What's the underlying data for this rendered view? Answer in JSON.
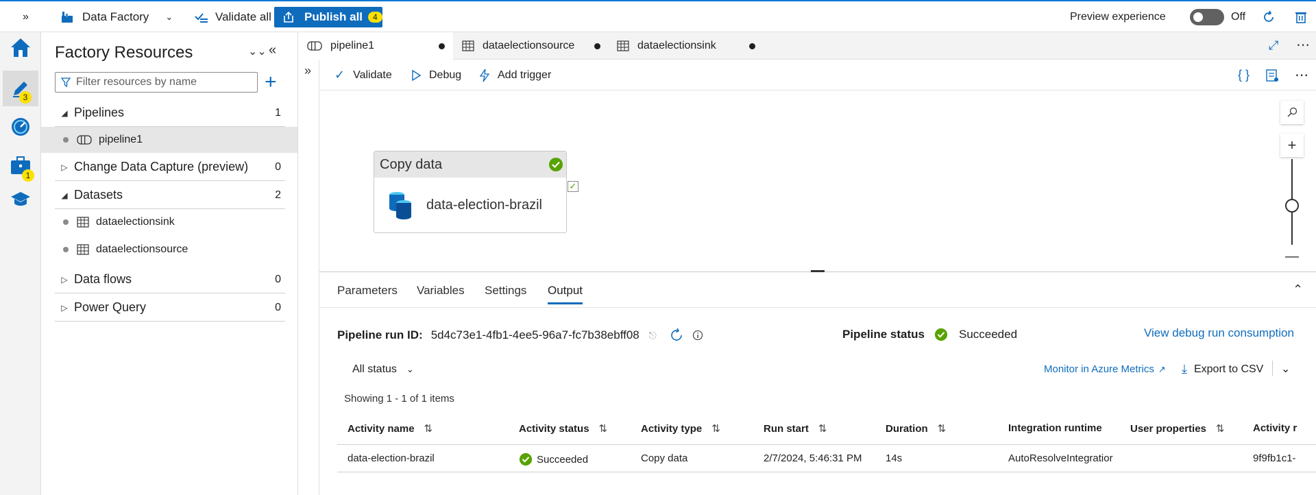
{
  "topbar": {
    "factory_label": "Data Factory",
    "validate_all": "Validate all",
    "publish_all": "Publish all",
    "publish_count": "4",
    "preview_label": "Preview experience",
    "toggle_state": "Off"
  },
  "rail": {
    "author_badge": "3",
    "manage_badge": "1"
  },
  "resources": {
    "title": "Factory Resources",
    "filter_placeholder": "Filter resources by name",
    "groups": [
      {
        "label": "Pipelines",
        "count": "1"
      },
      {
        "label": "Change Data Capture (preview)",
        "count": "0"
      },
      {
        "label": "Datasets",
        "count": "2"
      },
      {
        "label": "Data flows",
        "count": "0"
      },
      {
        "label": "Power Query",
        "count": "0"
      }
    ],
    "pipelines": [
      "pipeline1"
    ],
    "datasets": [
      "dataelectionsink",
      "dataelectionsource"
    ]
  },
  "tabs": [
    "pipeline1",
    "dataelectionsource",
    "dataelectionsink"
  ],
  "toolbar": {
    "validate": "Validate",
    "debug": "Debug",
    "add_trigger": "Add trigger"
  },
  "canvas": {
    "activity_type": "Copy data",
    "activity_name": "data-election-brazil"
  },
  "panel": {
    "tabs": [
      "Parameters",
      "Variables",
      "Settings",
      "Output"
    ],
    "run_id_label": "Pipeline run ID:",
    "run_id": "5d4c73e1-4fb1-4ee5-96a7-fc7b38ebff08",
    "status_label": "Pipeline status",
    "status_value": "Succeeded",
    "view_consumption": "View debug run consumption",
    "all_status": "All status",
    "monitor_link": "Monitor in Azure Metrics",
    "export_csv": "Export to CSV",
    "showing": "Showing 1 - 1 of 1 items"
  },
  "table": {
    "columns": [
      "Activity name",
      "Activity status",
      "Activity type",
      "Run start",
      "Duration",
      "Integration runtime",
      "User properties",
      "Activity r"
    ],
    "rows": [
      {
        "name": "data-election-brazil",
        "status": "Succeeded",
        "type": "Copy data",
        "run_start": "2/7/2024, 5:46:31 PM",
        "duration": "14s",
        "runtime": "AutoResolveIntegratior",
        "user_props": "",
        "activity_run": "9f9fb1c1-"
      }
    ]
  },
  "colors": {
    "accent": "#0f6cbd",
    "success": "#57a300",
    "badge": "#fce100"
  }
}
